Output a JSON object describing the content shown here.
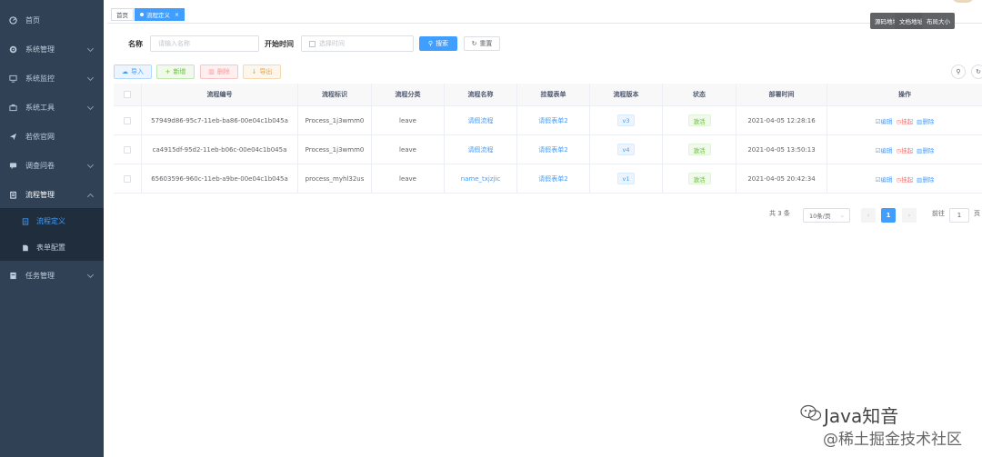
{
  "sidebar": {
    "items": [
      {
        "label": "首页",
        "icon": "dashboard-icon"
      },
      {
        "label": "系统管理",
        "icon": "gear-icon"
      },
      {
        "label": "系统监控",
        "icon": "monitor-icon"
      },
      {
        "label": "系统工具",
        "icon": "toolbox-icon"
      },
      {
        "label": "若依官网",
        "icon": "send-icon"
      },
      {
        "label": "调查问卷",
        "icon": "message-icon"
      },
      {
        "label": "流程管理",
        "icon": "clipboard-icon"
      },
      {
        "label": "任务管理",
        "icon": "task-icon"
      }
    ],
    "sub_items": [
      {
        "label": "流程定义",
        "icon": "form-icon"
      },
      {
        "label": "表单配置",
        "icon": "document-icon"
      }
    ]
  },
  "tags": {
    "home": "首页",
    "current": "流程定义",
    "close": "×"
  },
  "tooltips": {
    "source": "源码地址",
    "docs": "文档地址",
    "layout": "布局大小"
  },
  "search": {
    "name_label": "名称",
    "name_placeholder": "请输入名称",
    "time_label": "开始时间",
    "time_placeholder": "选择时间",
    "search_button": "搜索",
    "reset_button": "重置"
  },
  "toolbar": {
    "import": "导入",
    "add": "新增",
    "delete": "删除",
    "export": "导出"
  },
  "table": {
    "columns": [
      "流程编号",
      "流程标识",
      "流程分类",
      "流程名称",
      "挂载表单",
      "流程版本",
      "状态",
      "部署时间",
      "操作"
    ],
    "rows": [
      {
        "id": "57949d86-95c7-11eb-ba86-00e04c1b045a",
        "key": "Process_1j3wmm0",
        "category": "leave",
        "name": "请假流程",
        "form": "请假表单2",
        "version": "v3",
        "status": "激活",
        "time": "2021-04-05 12:28:16"
      },
      {
        "id": "ca4915df-95d2-11eb-b06c-00e04c1b045a",
        "key": "Process_1j3wmm0",
        "category": "leave",
        "name": "请假流程",
        "form": "请假表单2",
        "version": "v4",
        "status": "激活",
        "time": "2021-04-05 13:50:13"
      },
      {
        "id": "65603596-960c-11eb-a9be-00e04c1b045a",
        "key": "process_myhl32us",
        "category": "leave",
        "name": "name_txjzjic",
        "form": "请假表单2",
        "version": "v1",
        "status": "激活",
        "time": "2021-04-05 20:42:34"
      }
    ],
    "ops": {
      "edit": "编辑",
      "suspend": "挂起",
      "delete": "删除"
    }
  },
  "pagination": {
    "total": "共 3 条",
    "page_size": "10条/页",
    "prev": "‹",
    "current": "1",
    "next": "›",
    "goto": "前往",
    "goto_value": "1",
    "page_suffix": "页"
  },
  "watermark": {
    "line1": "Java知音",
    "line2": "@稀土掘金技术社区"
  },
  "colors": {
    "sidebar_bg": "#304156",
    "primary": "#409eff",
    "success": "#67c23a",
    "danger": "#f56c6c",
    "warning": "#e6a23c"
  }
}
